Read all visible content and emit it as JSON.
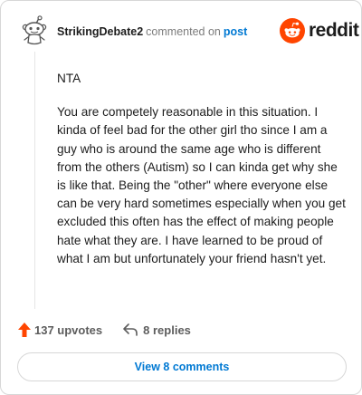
{
  "header": {
    "username": "StrikingDebate2",
    "action_text": "commented on",
    "post_link": "post"
  },
  "brand": {
    "wordmark": "reddit",
    "color": "#ff4500"
  },
  "comment": {
    "paragraphs": [
      "NTA",
      "You are competely reasonable in this situation. I kinda of feel bad for the other girl tho since I am a guy who is around the same age who is different from the others (Autism) so I can kinda get why she is like that. Being the \"other\" where everyone else can be very hard sometimes especially when you get excluded this often has the effect of making people hate what they are. I have learned to be proud of what I am but unfortunately your friend hasn't yet."
    ]
  },
  "actions": {
    "upvotes": "137 upvotes",
    "replies": "8 replies"
  },
  "footer": {
    "view_comments": "View 8 comments"
  },
  "icons": {
    "avatar": "snoo-avatar-icon",
    "logo": "reddit-logo-icon",
    "upvote": "upvote-arrow-icon",
    "reply": "reply-arrow-icon"
  },
  "colors": {
    "upvote": "#ff4500",
    "link": "#0079d3",
    "muted": "#7c7c7c"
  }
}
